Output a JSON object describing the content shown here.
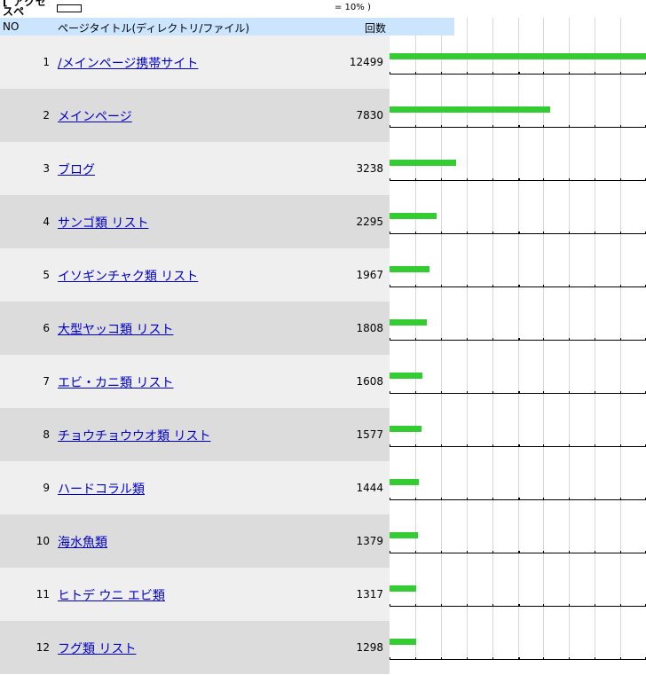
{
  "topbar": {
    "corner_label": "[ アクセスペ",
    "scale_note": "= 10% )"
  },
  "header": {
    "no_label": "NO",
    "title_label": "ページタイトル(ディレクトリ/ファイル)",
    "count_label": "回数"
  },
  "chart_data": {
    "type": "bar",
    "orientation": "horizontal",
    "categories": [
      "/メインページ携帯サイト",
      "メインページ",
      "ブログ",
      "サンゴ類 リスト",
      "イソギンチャク類 リスト",
      "大型ヤッコ類 リスト",
      "エビ・カニ類 リスト",
      "チョウチョウウオ類 リスト",
      "ハードコラル類",
      "海水魚類",
      "ヒトデ ウニ エビ類",
      "フグ類 リスト"
    ],
    "values": [
      12499,
      7830,
      3238,
      2295,
      1967,
      1808,
      1608,
      1577,
      1444,
      1379,
      1317,
      1298
    ],
    "xlim": [
      0,
      12499
    ],
    "bar_color": "#33cc33",
    "grid": true
  },
  "rows": [
    {
      "no": "1",
      "title": "/メインページ携帯サイト",
      "count": "12499"
    },
    {
      "no": "2",
      "title": "メインページ",
      "count": "7830"
    },
    {
      "no": "3",
      "title": "ブログ",
      "count": "3238"
    },
    {
      "no": "4",
      "title": "サンゴ類 リスト",
      "count": "2295"
    },
    {
      "no": "5",
      "title": "イソギンチャク類 リスト",
      "count": "1967"
    },
    {
      "no": "6",
      "title": "大型ヤッコ類 リスト",
      "count": "1808"
    },
    {
      "no": "7",
      "title": "エビ・カニ類 リスト",
      "count": "1608"
    },
    {
      "no": "8",
      "title": "チョウチョウウオ類 リスト",
      "count": "1577"
    },
    {
      "no": "9",
      "title": "ハードコラル類",
      "count": "1444"
    },
    {
      "no": "10",
      "title": "海水魚類",
      "count": "1379"
    },
    {
      "no": "11",
      "title": "ヒトデ ウニ エビ類",
      "count": "1317"
    },
    {
      "no": "12",
      "title": "フグ類 リスト",
      "count": "1298"
    }
  ],
  "colors": {
    "header_bg": "#cce5ff",
    "row_odd_bg": "#efefef",
    "row_even_bg": "#dcdcdc",
    "link": "#0000cc",
    "bar": "#33cc33"
  }
}
